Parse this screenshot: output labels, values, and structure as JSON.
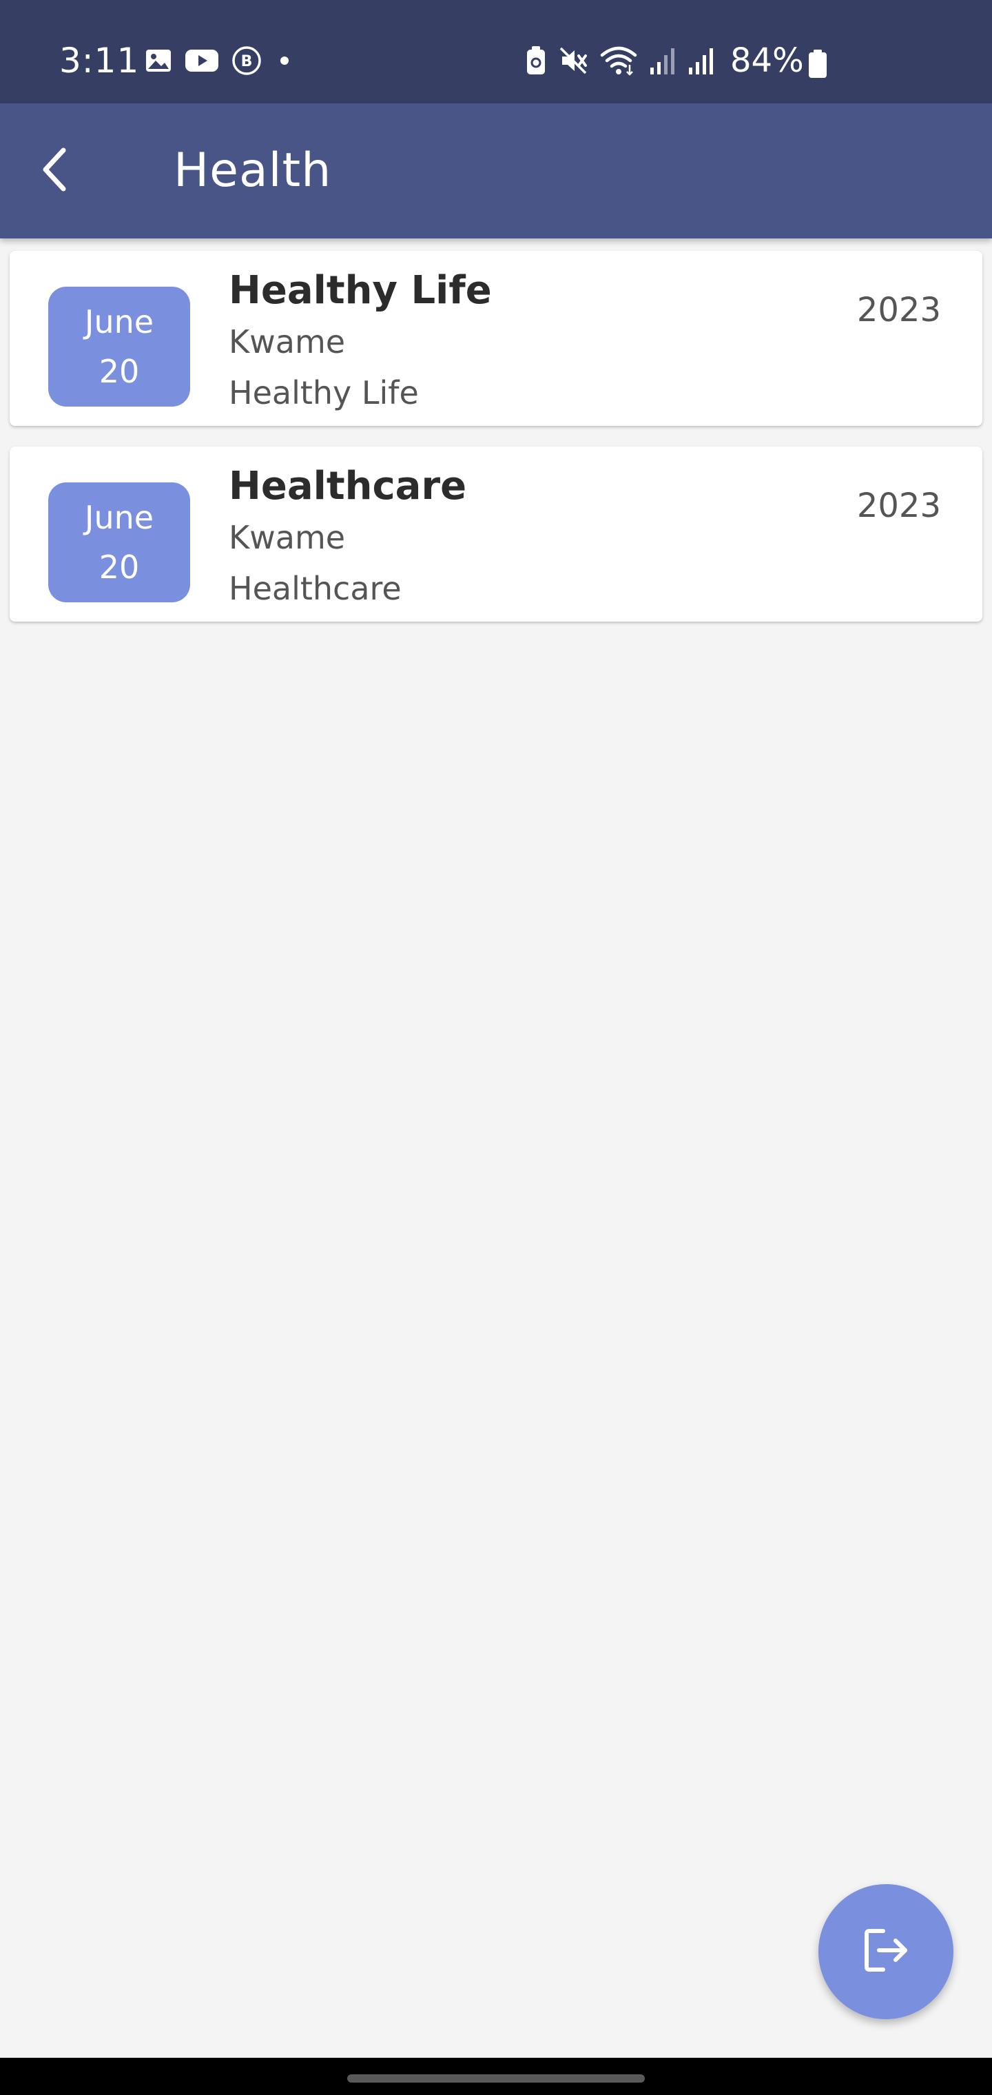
{
  "status_bar": {
    "time": "3:11",
    "battery_percent": "84%",
    "left_icons": [
      "gallery-icon",
      "youtube-icon",
      "b-notification-icon",
      "dot-icon"
    ],
    "right_icons": [
      "battery-saver-icon",
      "mute-icon",
      "wifi-icon",
      "signal-icon",
      "signal-icon"
    ]
  },
  "app_bar": {
    "title": "Health",
    "back_icon": "chevron-left-icon"
  },
  "items": [
    {
      "month": "June",
      "day": "20",
      "title": "Healthy Life",
      "author": "Kwame",
      "subtitle": "Healthy Life",
      "year": "2023"
    },
    {
      "month": "June",
      "day": "20",
      "title": "Healthcare",
      "author": "Kwame",
      "subtitle": "Healthcare",
      "year": "2023"
    }
  ],
  "fab": {
    "icon": "logout-icon"
  },
  "colors": {
    "status_bar": "#363f63",
    "app_bar": "#4a5587",
    "accent": "#7b8fdf",
    "background": "#f4f4f4"
  }
}
